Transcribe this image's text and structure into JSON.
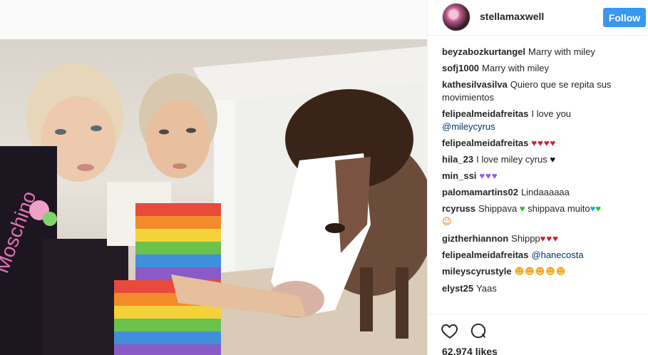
{
  "post": {
    "username": "stellamaxwell",
    "follow_label": "Follow",
    "likes": "62,974 likes"
  },
  "comments": [
    {
      "user": "beyzabozkurtangel",
      "text": "Marry with miley"
    },
    {
      "user": "sofj1000",
      "text": "Marry with miley"
    },
    {
      "user": "kathesilvasilva",
      "text": "Quiero que se repita sus movimientos"
    },
    {
      "user": "felipealmeidafreitas",
      "text": "I love you",
      "mention": "@mileycyrus"
    },
    {
      "user": "felipealmeidafreitas",
      "emoji": "♥♥♥♥"
    },
    {
      "user": "hila_23",
      "text": "I love miley cyrus",
      "emoji": "♥"
    },
    {
      "user": "min_ssi",
      "emoji": "♥♥♥"
    },
    {
      "user": "palomamartins02",
      "text": "Lindaaaaaa"
    },
    {
      "user": "rcyruss",
      "text": "Shippava",
      "text2": "shippava muito",
      "emoji_a": "♥",
      "emoji_b": "♥",
      "emoji_c": "♥",
      "emoji_d": "☺"
    },
    {
      "user": "giztherhiannon",
      "text": "Shippp",
      "emoji": "♥♥♥"
    },
    {
      "user": "felipealmeidafreitas",
      "mention": "@hanecosta"
    },
    {
      "user": "mileyscyrustyle",
      "emoji": "☻☻☻☻☻"
    },
    {
      "user": "elyst25",
      "text": "Yaas"
    }
  ],
  "icons": {
    "like": "heart-outline-icon",
    "comment": "speech-bubble-icon",
    "avatar": "profile-avatar"
  },
  "colors": {
    "follow_button": "#3897f0",
    "mention": "#003569",
    "heart_red": "#d81b2c",
    "heart_purple": "#8a5cf5",
    "heart_green": "#2ec02e",
    "heart_blue": "#1ea0ff"
  }
}
